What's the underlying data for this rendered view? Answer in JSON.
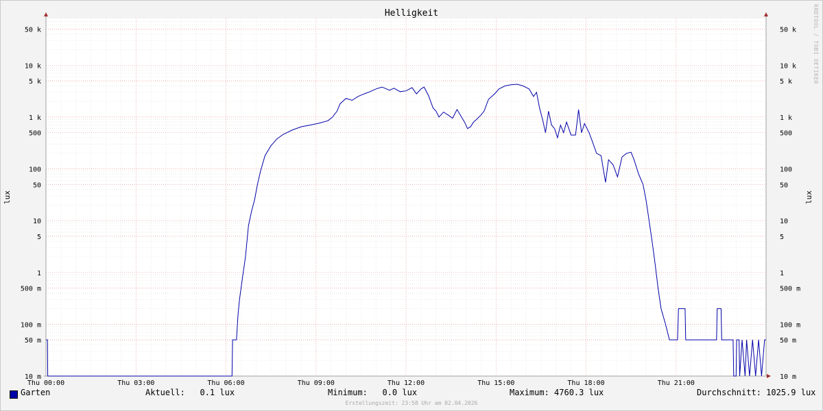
{
  "chart_data": {
    "type": "line",
    "title": "Helligkeit",
    "ylabel": "lux",
    "ylabel_right": "lux",
    "y_scale": "log",
    "ylim": [
      0.01,
      80000
    ],
    "xlim_hours": [
      0,
      24
    ],
    "grid": true,
    "y_ticks": [
      {
        "value": 50000,
        "label": "50 k"
      },
      {
        "value": 10000,
        "label": "10 k"
      },
      {
        "value": 5000,
        "label": "5 k"
      },
      {
        "value": 1000,
        "label": "1 k"
      },
      {
        "value": 500,
        "label": "500"
      },
      {
        "value": 100,
        "label": "100"
      },
      {
        "value": 50,
        "label": "50"
      },
      {
        "value": 10,
        "label": "10"
      },
      {
        "value": 5,
        "label": "5"
      },
      {
        "value": 1,
        "label": "1"
      },
      {
        "value": 0.5,
        "label": "500 m"
      },
      {
        "value": 0.1,
        "label": "100 m"
      },
      {
        "value": 0.05,
        "label": "50 m"
      },
      {
        "value": 0.01,
        "label": "10 m"
      }
    ],
    "x_ticks": [
      {
        "value": 0,
        "label": "Thu 00:00"
      },
      {
        "value": 3,
        "label": "Thu 03:00"
      },
      {
        "value": 6,
        "label": "Thu 06:00"
      },
      {
        "value": 9,
        "label": "Thu 09:00"
      },
      {
        "value": 12,
        "label": "Thu 12:00"
      },
      {
        "value": 15,
        "label": "Thu 15:00"
      },
      {
        "value": 18,
        "label": "Thu 18:00"
      },
      {
        "value": 21,
        "label": "Thu 21:00"
      }
    ],
    "series": [
      {
        "name": "Garten",
        "color": "#0000a8",
        "points": [
          [
            0.0,
            0.05
          ],
          [
            0.05,
            0.05
          ],
          [
            0.06,
            0.01
          ],
          [
            6.2,
            0.01
          ],
          [
            6.22,
            0.05
          ],
          [
            6.35,
            0.05
          ],
          [
            6.4,
            0.15
          ],
          [
            6.45,
            0.3
          ],
          [
            6.55,
            0.8
          ],
          [
            6.65,
            2
          ],
          [
            6.75,
            8
          ],
          [
            6.85,
            15
          ],
          [
            6.95,
            25
          ],
          [
            7.05,
            50
          ],
          [
            7.15,
            90
          ],
          [
            7.3,
            180
          ],
          [
            7.5,
            280
          ],
          [
            7.7,
            380
          ],
          [
            7.9,
            460
          ],
          [
            8.2,
            560
          ],
          [
            8.5,
            650
          ],
          [
            8.8,
            700
          ],
          [
            9.1,
            760
          ],
          [
            9.4,
            850
          ],
          [
            9.55,
            1000
          ],
          [
            9.7,
            1300
          ],
          [
            9.8,
            1800
          ],
          [
            10.0,
            2300
          ],
          [
            10.2,
            2100
          ],
          [
            10.4,
            2500
          ],
          [
            10.6,
            2800
          ],
          [
            10.8,
            3100
          ],
          [
            11.0,
            3500
          ],
          [
            11.2,
            3800
          ],
          [
            11.45,
            3300
          ],
          [
            11.6,
            3600
          ],
          [
            11.8,
            3100
          ],
          [
            12.0,
            3200
          ],
          [
            12.2,
            3700
          ],
          [
            12.35,
            2800
          ],
          [
            12.5,
            3500
          ],
          [
            12.6,
            3800
          ],
          [
            12.75,
            2600
          ],
          [
            12.9,
            1500
          ],
          [
            13.0,
            1300
          ],
          [
            13.1,
            1000
          ],
          [
            13.25,
            1250
          ],
          [
            13.4,
            1100
          ],
          [
            13.55,
            950
          ],
          [
            13.7,
            1400
          ],
          [
            13.85,
            1000
          ],
          [
            13.95,
            800
          ],
          [
            14.05,
            600
          ],
          [
            14.15,
            650
          ],
          [
            14.25,
            800
          ],
          [
            14.35,
            900
          ],
          [
            14.5,
            1100
          ],
          [
            14.6,
            1300
          ],
          [
            14.75,
            2200
          ],
          [
            14.95,
            2800
          ],
          [
            15.1,
            3500
          ],
          [
            15.3,
            4000
          ],
          [
            15.5,
            4200
          ],
          [
            15.7,
            4300
          ],
          [
            15.9,
            4000
          ],
          [
            16.1,
            3500
          ],
          [
            16.25,
            2500
          ],
          [
            16.35,
            3000
          ],
          [
            16.45,
            1500
          ],
          [
            16.55,
            900
          ],
          [
            16.65,
            500
          ],
          [
            16.75,
            1300
          ],
          [
            16.85,
            700
          ],
          [
            16.95,
            600
          ],
          [
            17.05,
            400
          ],
          [
            17.15,
            700
          ],
          [
            17.25,
            500
          ],
          [
            17.35,
            800
          ],
          [
            17.5,
            450
          ],
          [
            17.65,
            450
          ],
          [
            17.75,
            1400
          ],
          [
            17.85,
            500
          ],
          [
            17.95,
            750
          ],
          [
            18.1,
            500
          ],
          [
            18.2,
            350
          ],
          [
            18.35,
            200
          ],
          [
            18.5,
            180
          ],
          [
            18.65,
            55
          ],
          [
            18.75,
            150
          ],
          [
            18.9,
            120
          ],
          [
            19.05,
            70
          ],
          [
            19.2,
            170
          ],
          [
            19.35,
            200
          ],
          [
            19.5,
            210
          ],
          [
            19.6,
            150
          ],
          [
            19.75,
            80
          ],
          [
            19.9,
            50
          ],
          [
            20.0,
            25
          ],
          [
            20.1,
            10
          ],
          [
            20.2,
            4
          ],
          [
            20.3,
            1.5
          ],
          [
            20.4,
            0.5
          ],
          [
            20.5,
            0.2
          ],
          [
            20.65,
            0.1
          ],
          [
            20.78,
            0.05
          ],
          [
            21.05,
            0.05
          ],
          [
            21.08,
            0.2
          ],
          [
            21.3,
            0.2
          ],
          [
            21.32,
            0.05
          ],
          [
            22.35,
            0.05
          ],
          [
            22.37,
            0.2
          ],
          [
            22.5,
            0.2
          ],
          [
            22.52,
            0.05
          ],
          [
            22.9,
            0.05
          ],
          [
            22.92,
            0.01
          ],
          [
            23.0,
            0.01
          ],
          [
            23.02,
            0.05
          ],
          [
            23.1,
            0.05
          ],
          [
            23.12,
            0.01
          ],
          [
            23.2,
            0.05
          ],
          [
            23.3,
            0.01
          ],
          [
            23.35,
            0.05
          ],
          [
            23.45,
            0.01
          ],
          [
            23.55,
            0.05
          ],
          [
            23.65,
            0.01
          ],
          [
            23.75,
            0.05
          ],
          [
            23.85,
            0.01
          ],
          [
            23.95,
            0.05
          ],
          [
            24.0,
            0.05
          ]
        ]
      }
    ]
  },
  "legend": {
    "series_name": "Garten",
    "aktuell": "Aktuell:   0.1 lux",
    "minimum": "Minimum:   0.0 lux",
    "maximum": "Maximum: 4760.3 lux",
    "durchschnitt": "Durchschnitt: 1025.9 lux"
  },
  "footer": "Erstellungszeit: 23:58 Uhr am 02.04.2026",
  "watermark": "RRDTOOL / TOBI OETIKER"
}
